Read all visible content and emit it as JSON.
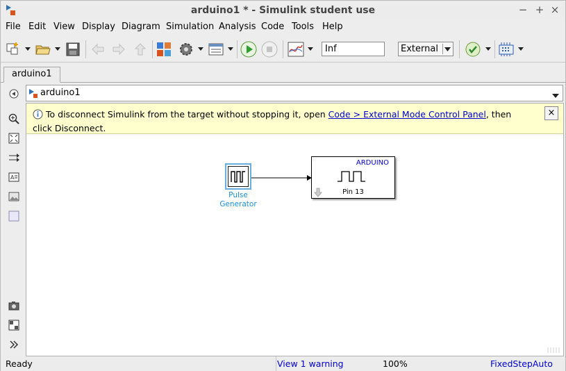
{
  "window": {
    "title": "arduino1 * - Simulink student use",
    "controls": [
      "−",
      "+",
      "×"
    ]
  },
  "menu": [
    "File",
    "Edit",
    "View",
    "Display",
    "Diagram",
    "Simulation",
    "Analysis",
    "Code",
    "Tools",
    "Help"
  ],
  "toolbar": {
    "stop_time": "Inf",
    "sim_mode": "External"
  },
  "tab": {
    "label": "arduino1"
  },
  "breadcrumb": {
    "path": "arduino1"
  },
  "notice": {
    "prefix": "To disconnect Simulink from the target without stopping it, open ",
    "link": "Code > External Mode Control Panel",
    "suffix": ", then click Disconnect.",
    "close": "×"
  },
  "blocks": {
    "pulse": {
      "label_line1": "Pulse",
      "label_line2": "Generator"
    },
    "arduino": {
      "header": "ARDUINO",
      "port_label": "Pin 13"
    }
  },
  "status": {
    "ready": "Ready",
    "warning": "View 1 warning",
    "zoom": "100%",
    "solver": "FixedStepAuto"
  },
  "colors": {
    "notice_bg": "#ffffcd",
    "block_blue": "#1a8fd6",
    "arduino_text": "#0000cc"
  }
}
